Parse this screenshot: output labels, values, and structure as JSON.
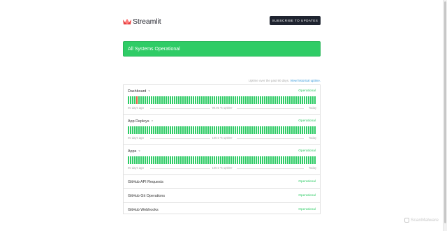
{
  "header": {
    "logo_text": "Streamlit",
    "subscribe_label": "Subscribe to Updates"
  },
  "banner": {
    "text": "All Systems Operational",
    "color": "#2fcc66"
  },
  "uptime_meta": {
    "text": "Uptime over the past 90 days.",
    "link": "View historical uptime."
  },
  "components": [
    {
      "name": "Dashboard",
      "status": "Operational",
      "has_help": true,
      "has_bars": true,
      "axis_left": "90 days ago",
      "uptime": "99.95 % uptime",
      "axis_right": "Today"
    },
    {
      "name": "App Deploys",
      "status": "Operational",
      "has_help": true,
      "has_bars": true,
      "axis_left": "90 days ago",
      "uptime": "100.0 % uptime",
      "axis_right": "Today"
    },
    {
      "name": "Apps",
      "status": "Operational",
      "has_help": true,
      "has_bars": true,
      "axis_left": "90 days ago",
      "uptime": "100.0 % uptime",
      "axis_right": "Today"
    },
    {
      "name": "GitHub API Requests",
      "status": "Operational",
      "has_help": false,
      "has_bars": false
    },
    {
      "name": "GitHub Git Operations",
      "status": "Operational",
      "has_help": false,
      "has_bars": false
    },
    {
      "name": "GitHub Webhooks",
      "status": "Operational",
      "has_help": false,
      "has_bars": false
    }
  ],
  "help_glyph": "?",
  "watermark": "ScanMalware"
}
